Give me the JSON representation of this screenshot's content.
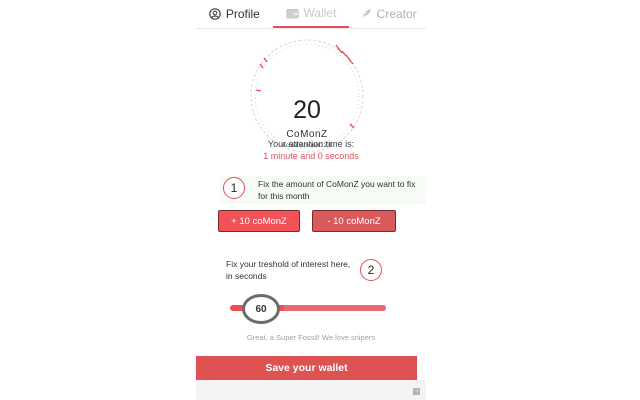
{
  "tabs": [
    {
      "label": "Profile",
      "icon": "user-circle-icon"
    },
    {
      "label": "Wallet",
      "icon": "wallet-icon"
    },
    {
      "label": "Creator",
      "icon": "feather-icon"
    }
  ],
  "active_tab": "Wallet",
  "gauge": {
    "value": "20",
    "unit": "CoMonZ",
    "actual_amount": "Actual Amount: 2 €"
  },
  "attention": {
    "label": "Your attention time is:",
    "time": "1 minute and 0 seconds"
  },
  "fix_amount": {
    "step": "1",
    "text": "Fix the amount of CoMonZ you want to fix for this month",
    "plus_label": "+ 10 coMonZ",
    "minus_label": "- 10 coMonZ"
  },
  "threshold": {
    "step": "2",
    "text": "Fix your treshold of interest here, in seconds",
    "slider_value": "60",
    "message": "Great, a Super Fossil! We love snipers"
  },
  "save_label": "Save your wallet",
  "colors": {
    "accent": "#e0505a",
    "button": "#de5252"
  }
}
